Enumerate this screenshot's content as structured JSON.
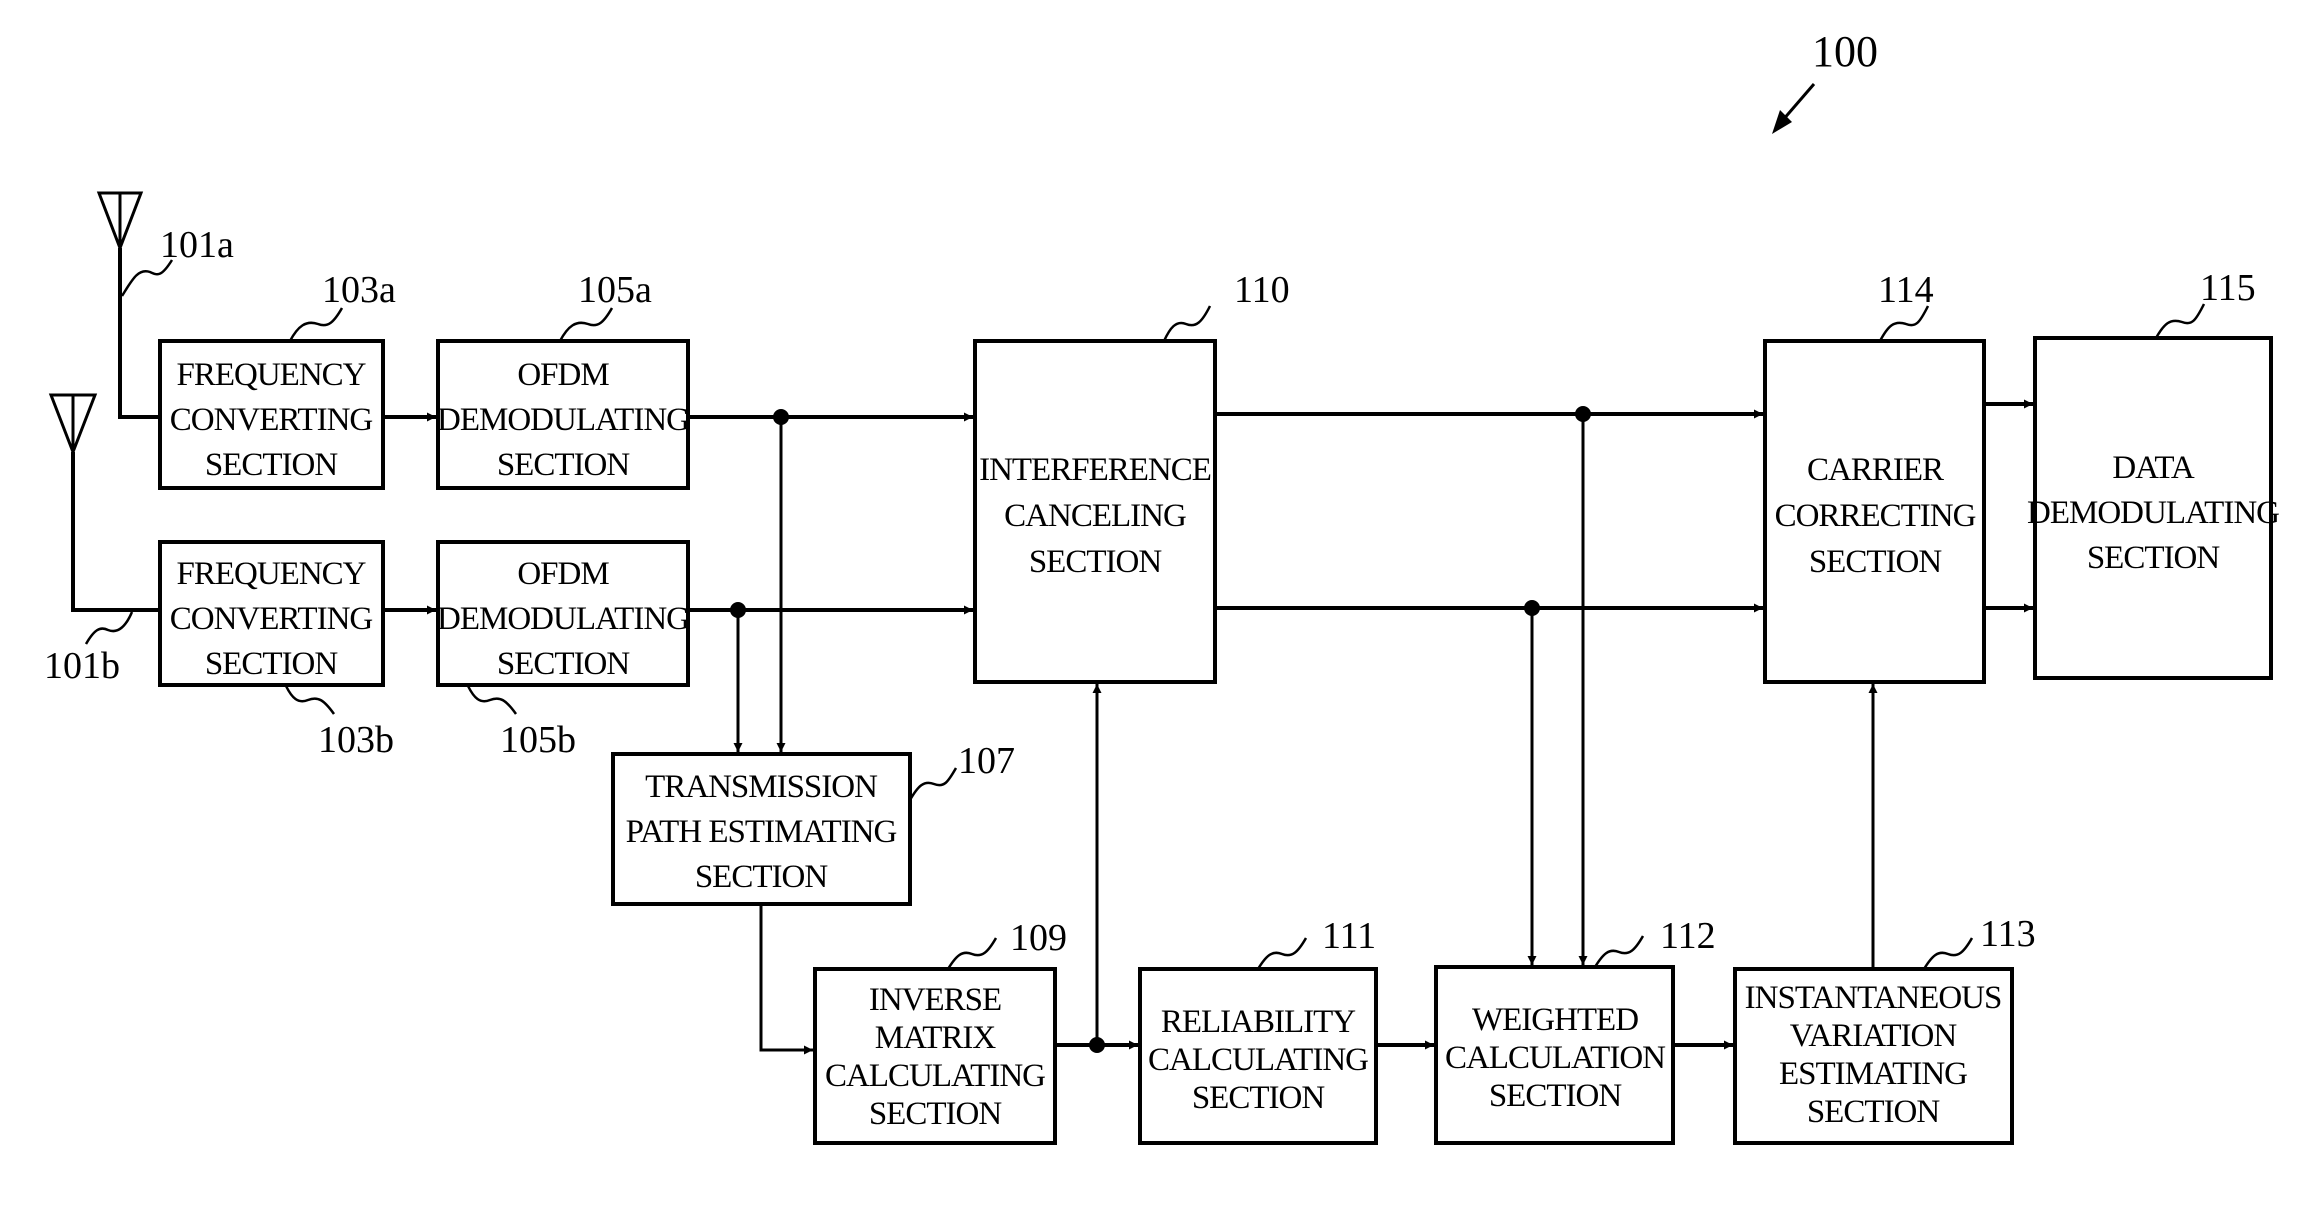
{
  "figure": {
    "reference": "100"
  },
  "antennas": [
    {
      "id": "antenna-a",
      "ref": "101a"
    },
    {
      "id": "antenna-b",
      "ref": "101b"
    }
  ],
  "blocks": {
    "freq_a": {
      "ref": "103a",
      "lines": [
        "FREQUENCY",
        "CONVERTING",
        "SECTION"
      ]
    },
    "ofdm_a": {
      "ref": "105a",
      "lines": [
        "OFDM",
        "DEMODULATING",
        "SECTION"
      ]
    },
    "freq_b": {
      "ref": "103b",
      "lines": [
        "FREQUENCY",
        "CONVERTING",
        "SECTION"
      ]
    },
    "ofdm_b": {
      "ref": "105b",
      "lines": [
        "OFDM",
        "DEMODULATING",
        "SECTION"
      ]
    },
    "tpe": {
      "ref": "107",
      "lines": [
        "TRANSMISSION",
        "PATH ESTIMATING",
        "SECTION"
      ]
    },
    "inv": {
      "ref": "109",
      "lines": [
        "INVERSE",
        "MATRIX",
        "CALCULATING",
        "SECTION"
      ]
    },
    "ic": {
      "ref": "110",
      "lines": [
        "INTERFERENCE",
        "CANCELING",
        "SECTION"
      ]
    },
    "rel": {
      "ref": "111",
      "lines": [
        "RELIABILITY",
        "CALCULATING",
        "SECTION"
      ]
    },
    "wc": {
      "ref": "112",
      "lines": [
        "WEIGHTED",
        "CALCULATION",
        "SECTION"
      ]
    },
    "ive": {
      "ref": "113",
      "lines": [
        "INSTANTANEOUS",
        "VARIATION",
        "ESTIMATING",
        "SECTION"
      ]
    },
    "cc": {
      "ref": "114",
      "lines": [
        "CARRIER",
        "CORRECTING",
        "SECTION"
      ]
    },
    "dd": {
      "ref": "115",
      "lines": [
        "DATA",
        "DEMODULATING",
        "SECTION"
      ]
    }
  },
  "connections": [
    {
      "from": "antenna-a",
      "to": "freq_a"
    },
    {
      "from": "antenna-b",
      "to": "freq_b"
    },
    {
      "from": "freq_a",
      "to": "ofdm_a"
    },
    {
      "from": "freq_b",
      "to": "ofdm_b"
    },
    {
      "from": "ofdm_a",
      "to": "ic"
    },
    {
      "from": "ofdm_b",
      "to": "ic"
    },
    {
      "from": "ofdm_a",
      "to": "tpe"
    },
    {
      "from": "ofdm_b",
      "to": "tpe"
    },
    {
      "from": "tpe",
      "to": "inv"
    },
    {
      "from": "inv",
      "to": "ic"
    },
    {
      "from": "inv",
      "to": "rel"
    },
    {
      "from": "rel",
      "to": "wc"
    },
    {
      "from": "ic",
      "to": "cc"
    },
    {
      "from": "ic",
      "to": "cc"
    },
    {
      "from": "ic",
      "to": "wc"
    },
    {
      "from": "ic",
      "to": "wc"
    },
    {
      "from": "wc",
      "to": "ive"
    },
    {
      "from": "ive",
      "to": "cc"
    },
    {
      "from": "cc",
      "to": "dd"
    },
    {
      "from": "cc",
      "to": "dd"
    }
  ]
}
